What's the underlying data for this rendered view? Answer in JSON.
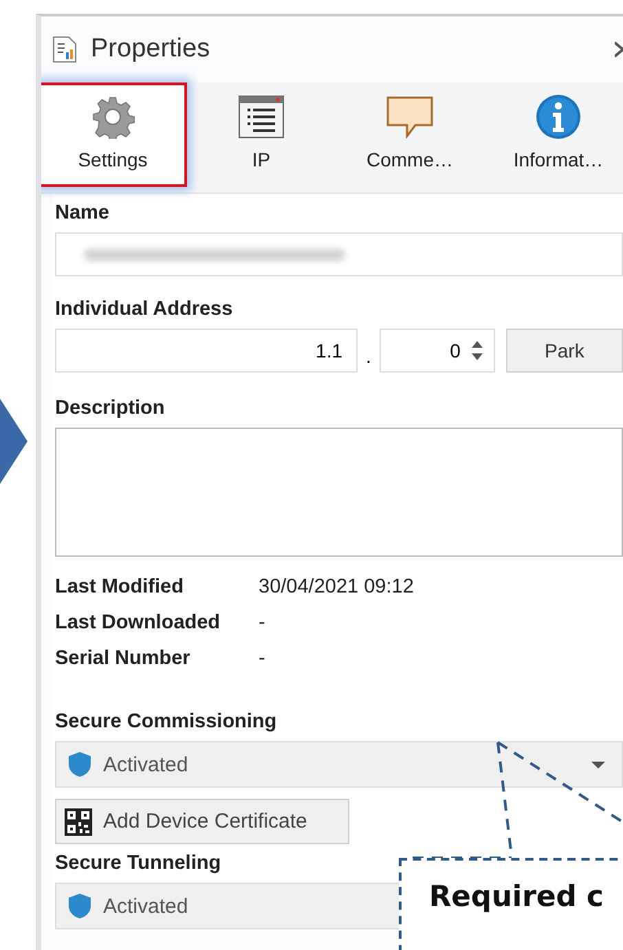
{
  "panel": {
    "title": "Properties"
  },
  "tabs": [
    {
      "kind": "settings",
      "label": "Settings",
      "selected": true
    },
    {
      "kind": "list",
      "label": "IP",
      "selected": false
    },
    {
      "kind": "comment",
      "label": "Comme…",
      "selected": false
    },
    {
      "kind": "info",
      "label": "Informat…",
      "selected": false
    }
  ],
  "name": {
    "label": "Name",
    "redacted": true
  },
  "individual_address": {
    "label": "Individual Address",
    "area_line": "1.1",
    "separator": ".",
    "device": "0",
    "button": "Park"
  },
  "description": {
    "label": "Description"
  },
  "details": [
    {
      "label": "Last Modified",
      "value": "30/04/2021 09:12"
    },
    {
      "label": "Last Downloaded",
      "value": "-"
    },
    {
      "label": "Serial Number",
      "value": "-"
    }
  ],
  "secure_commissioning": {
    "label": "Secure Commissioning",
    "value": "Activated",
    "button": "Add Device Certificate"
  },
  "secure_tunneling": {
    "label": "Secure Tunneling",
    "value": "Activated"
  },
  "callout": {
    "text": "Required c"
  }
}
